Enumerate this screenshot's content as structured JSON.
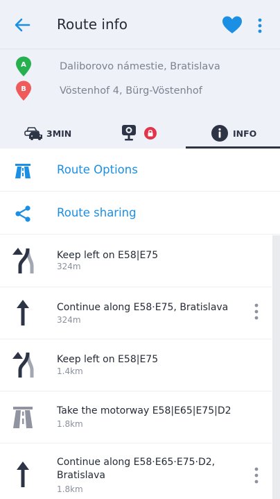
{
  "header": {
    "title": "Route info"
  },
  "waypoints": [
    {
      "marker": "A",
      "address": "Daliborovo námestie, Bratislava",
      "color": "#27b04e"
    },
    {
      "marker": "B",
      "address": "Vöstenhof 4, Bürg-Vöstenhof",
      "color": "#ef5b5b"
    }
  ],
  "tabs": [
    {
      "label": "3MIN"
    },
    {
      "label": ""
    },
    {
      "label": "INFO"
    }
  ],
  "options": [
    {
      "label": "Route Options"
    },
    {
      "label": "Route sharing"
    }
  ],
  "steps": [
    {
      "instruction": "Keep left on E58|E75",
      "distance": "324m",
      "icon": "keep-left-icon"
    },
    {
      "instruction": "Continue along E58·E75, Bratislava",
      "distance": "324m",
      "icon": "straight-arrow-icon"
    },
    {
      "instruction": "Keep left on E58|E75",
      "distance": "1.4km",
      "icon": "keep-left-icon"
    },
    {
      "instruction": "Take the motorway E58|E65|E75|D2",
      "distance": "1.8km",
      "icon": "motorway-icon"
    },
    {
      "instruction": "Continue along E58·E65·E75·D2, Bratislava",
      "distance": "1.8km",
      "icon": "straight-arrow-icon"
    }
  ],
  "colors": {
    "accent": "#1a8fe3",
    "dark": "#2d3445",
    "alert": "#e2344a"
  }
}
